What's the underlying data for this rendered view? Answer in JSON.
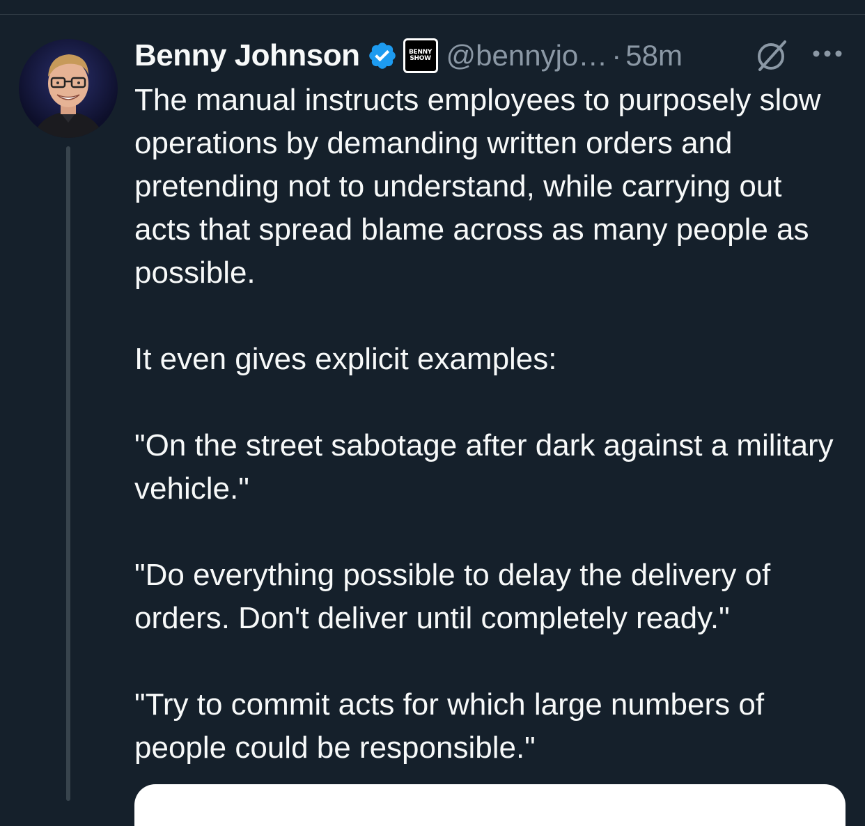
{
  "tweet": {
    "author": {
      "display_name": "Benny Johnson",
      "handle": "@bennyjo…",
      "affiliate_badge": "BENNY SHOW",
      "verified": true
    },
    "separator": "·",
    "timestamp": "58m",
    "icons": {
      "verified": "verified-badge-icon",
      "grok": "grok-icon",
      "more": "more-options-icon"
    },
    "paragraphs": [
      "The manual instructs employees to purposely slow operations by demanding written orders and pretending not to understand, while carrying out acts that spread blame across as many people as possible.",
      "It even gives explicit examples:",
      "\"On the street sabotage after dark against a military vehicle.\"",
      "\"Do everything possible to delay the delivery of orders. Don't deliver until completely ready.\"",
      "\"Try to commit acts for which large numbers of people could be responsible.\""
    ]
  },
  "colors": {
    "background": "#15202b",
    "text_primary": "#f7f9f9",
    "text_secondary": "#8b98a5",
    "verified_blue": "#1d9bf0",
    "thread_line": "#38444d"
  }
}
